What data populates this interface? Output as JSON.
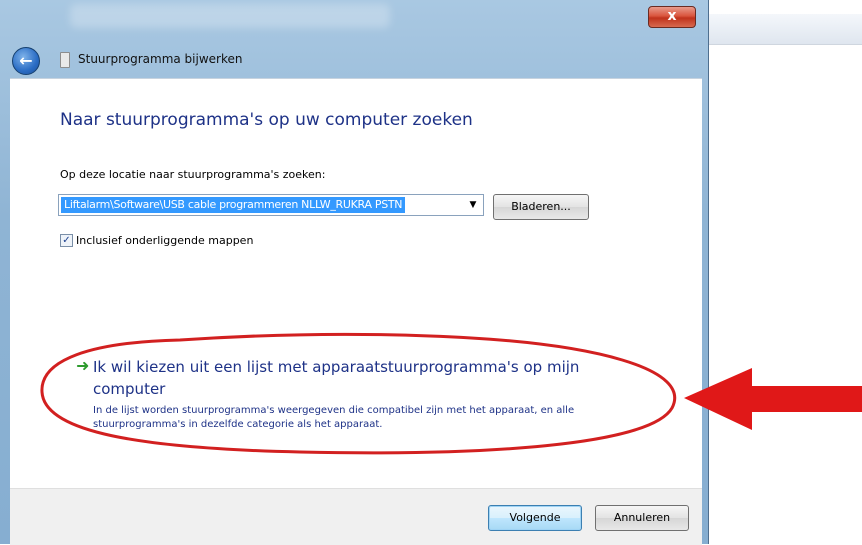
{
  "dialog": {
    "close_label": "x",
    "nav_title": "Stuurprogramma bijwerken"
  },
  "main": {
    "heading": "Naar stuurprogramma's op uw computer zoeken",
    "location_label": "Op deze locatie naar stuurprogramma's zoeken:",
    "path_value": "Liftalarm\\Software\\USB cable programmeren NLLW_RUKRA PSTN",
    "browse_label": "Bladeren...",
    "checkbox_label": "Inclusief onderliggende mappen",
    "checkbox_checked": true
  },
  "command_link": {
    "title": "Ik wil kiezen uit een lijst met apparaatstuurprogramma's op mijn computer",
    "description": "In de lijst worden stuurprogramma's weergegeven die compatibel zijn met het apparaat, en alle stuurprogramma's in dezelfde categorie als het apparaat."
  },
  "footer": {
    "next_label": "Volgende",
    "cancel_label": "Annuleren"
  },
  "icons": {
    "back": "back-arrow-icon",
    "device": "driver-icon",
    "command": "green-arrow-icon"
  },
  "colors": {
    "heading": "#1e3287",
    "annotation": "#e02020",
    "selection": "#3399ff"
  }
}
